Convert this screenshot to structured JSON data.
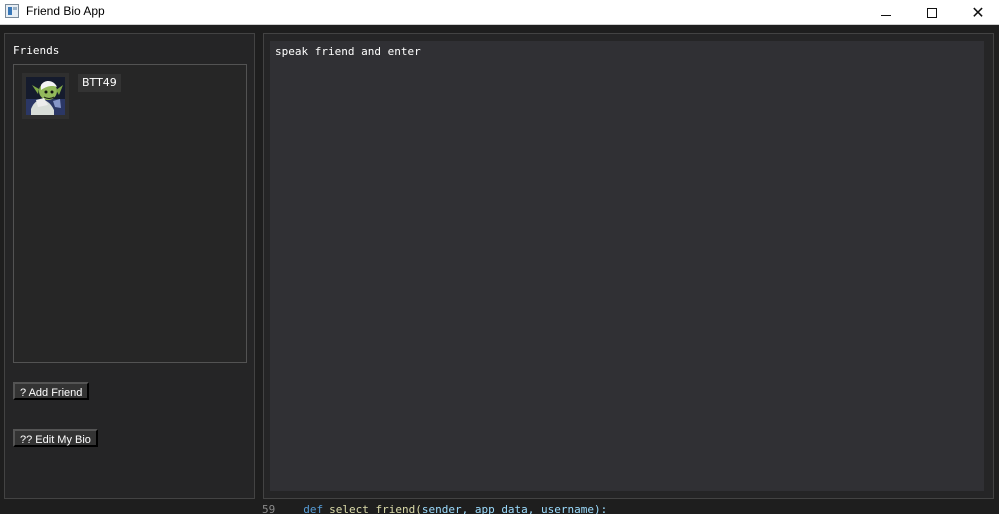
{
  "window": {
    "title": "Friend Bio App",
    "controls": {
      "minimize_icon": "minimize-icon",
      "maximize_icon": "maximize-icon",
      "close_icon": "close-icon",
      "close_glyph": "✕"
    }
  },
  "left_panel": {
    "title": "Friends",
    "friends": [
      {
        "name": "BTT49",
        "avatar_icon": "avatar-image"
      }
    ],
    "buttons": {
      "add_friend": "? Add Friend",
      "edit_bio": "?? Edit My Bio"
    }
  },
  "right_panel": {
    "bio_text": "speak friend and enter"
  },
  "background_code": {
    "line_number": "59",
    "keyword": "def",
    "function": "select_friend(",
    "args": "sender, app_data, username):"
  },
  "colors": {
    "panel": "#252526",
    "text_area": "#303034",
    "button": "#333333",
    "text": "#ffffff"
  }
}
